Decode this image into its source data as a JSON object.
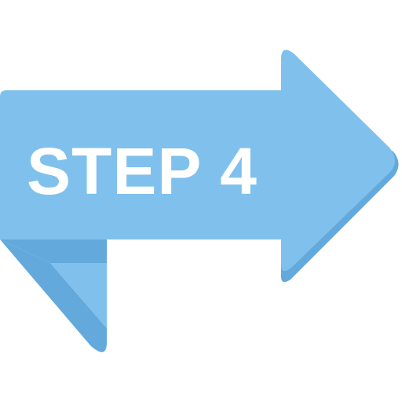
{
  "arrow": {
    "label": "STEP 4",
    "colors": {
      "main": "#7FC1EC",
      "shadow": "#63A9DB",
      "text": "#FFFFFF",
      "background": "#FFFFFF"
    }
  },
  "icons": {
    "arrow": "right-arrow-icon",
    "fold": "folded-tail-icon"
  }
}
